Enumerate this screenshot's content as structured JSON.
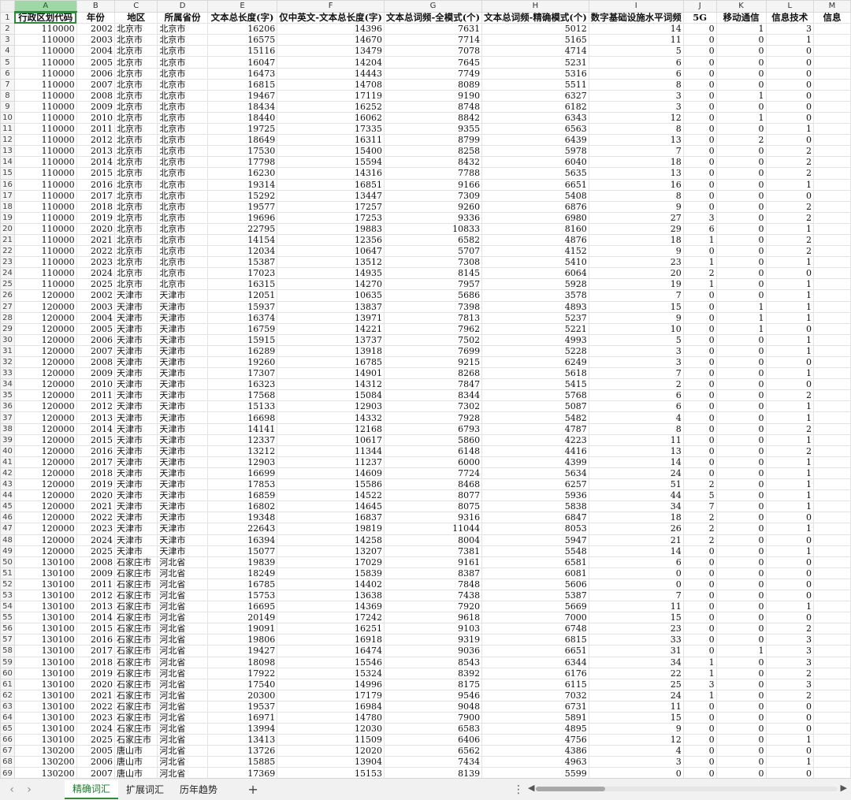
{
  "columns": [
    "A",
    "B",
    "C",
    "D",
    "E",
    "F",
    "G",
    "H",
    "I",
    "J",
    "K",
    "L",
    "M"
  ],
  "active_cell": "A1",
  "header": [
    "行政区划代码",
    "年份",
    "地区",
    "所属省份",
    "文本总长度(字)",
    "仅中英文-文本总长度(字)",
    "文本总词频-全模式(个)",
    "文本总词频-精确模式(个)",
    "数字基础设施水平词频",
    "5G",
    "移动通信",
    "信息技术",
    "信息"
  ],
  "rows": [
    [
      "110000",
      "2002",
      "北京市",
      "北京市",
      "16206",
      "14396",
      "7631",
      "5012",
      "14",
      "0",
      "1",
      "3"
    ],
    [
      "110000",
      "2003",
      "北京市",
      "北京市",
      "16575",
      "14670",
      "7714",
      "5165",
      "11",
      "0",
      "0",
      "1"
    ],
    [
      "110000",
      "2004",
      "北京市",
      "北京市",
      "15116",
      "13479",
      "7078",
      "4714",
      "5",
      "0",
      "0",
      "0"
    ],
    [
      "110000",
      "2005",
      "北京市",
      "北京市",
      "16047",
      "14204",
      "7645",
      "5231",
      "6",
      "0",
      "0",
      "0"
    ],
    [
      "110000",
      "2006",
      "北京市",
      "北京市",
      "16473",
      "14443",
      "7749",
      "5316",
      "6",
      "0",
      "0",
      "0"
    ],
    [
      "110000",
      "2007",
      "北京市",
      "北京市",
      "16815",
      "14708",
      "8089",
      "5511",
      "8",
      "0",
      "0",
      "0"
    ],
    [
      "110000",
      "2008",
      "北京市",
      "北京市",
      "19467",
      "17119",
      "9190",
      "6327",
      "3",
      "0",
      "1",
      "0"
    ],
    [
      "110000",
      "2009",
      "北京市",
      "北京市",
      "18434",
      "16252",
      "8748",
      "6182",
      "3",
      "0",
      "0",
      "0"
    ],
    [
      "110000",
      "2010",
      "北京市",
      "北京市",
      "18440",
      "16062",
      "8842",
      "6343",
      "12",
      "0",
      "1",
      "0"
    ],
    [
      "110000",
      "2011",
      "北京市",
      "北京市",
      "19725",
      "17335",
      "9355",
      "6563",
      "8",
      "0",
      "0",
      "1"
    ],
    [
      "110000",
      "2012",
      "北京市",
      "北京市",
      "18649",
      "16311",
      "8799",
      "6439",
      "13",
      "0",
      "2",
      "0"
    ],
    [
      "110000",
      "2013",
      "北京市",
      "北京市",
      "17530",
      "15400",
      "8258",
      "5978",
      "7",
      "0",
      "0",
      "2"
    ],
    [
      "110000",
      "2014",
      "北京市",
      "北京市",
      "17798",
      "15594",
      "8432",
      "6040",
      "18",
      "0",
      "0",
      "2"
    ],
    [
      "110000",
      "2015",
      "北京市",
      "北京市",
      "16230",
      "14316",
      "7788",
      "5635",
      "13",
      "0",
      "0",
      "2"
    ],
    [
      "110000",
      "2016",
      "北京市",
      "北京市",
      "19314",
      "16851",
      "9166",
      "6651",
      "16",
      "0",
      "0",
      "1"
    ],
    [
      "110000",
      "2017",
      "北京市",
      "北京市",
      "15292",
      "13447",
      "7309",
      "5408",
      "8",
      "0",
      "0",
      "0"
    ],
    [
      "110000",
      "2018",
      "北京市",
      "北京市",
      "19577",
      "17257",
      "9260",
      "6876",
      "9",
      "0",
      "0",
      "2"
    ],
    [
      "110000",
      "2019",
      "北京市",
      "北京市",
      "19696",
      "17253",
      "9336",
      "6980",
      "27",
      "3",
      "0",
      "2"
    ],
    [
      "110000",
      "2020",
      "北京市",
      "北京市",
      "22795",
      "19883",
      "10833",
      "8160",
      "29",
      "6",
      "0",
      "1"
    ],
    [
      "110000",
      "2021",
      "北京市",
      "北京市",
      "14154",
      "12356",
      "6582",
      "4876",
      "18",
      "1",
      "0",
      "2"
    ],
    [
      "110000",
      "2022",
      "北京市",
      "北京市",
      "12034",
      "10647",
      "5707",
      "4152",
      "9",
      "0",
      "0",
      "2"
    ],
    [
      "110000",
      "2023",
      "北京市",
      "北京市",
      "15387",
      "13512",
      "7308",
      "5410",
      "23",
      "1",
      "0",
      "1"
    ],
    [
      "110000",
      "2024",
      "北京市",
      "北京市",
      "17023",
      "14935",
      "8145",
      "6064",
      "20",
      "2",
      "0",
      "0"
    ],
    [
      "110000",
      "2025",
      "北京市",
      "北京市",
      "16315",
      "14270",
      "7957",
      "5928",
      "19",
      "1",
      "0",
      "1"
    ],
    [
      "120000",
      "2002",
      "天津市",
      "天津市",
      "12051",
      "10635",
      "5686",
      "3578",
      "7",
      "0",
      "0",
      "1"
    ],
    [
      "120000",
      "2003",
      "天津市",
      "天津市",
      "15937",
      "13837",
      "7398",
      "4893",
      "15",
      "0",
      "1",
      "1"
    ],
    [
      "120000",
      "2004",
      "天津市",
      "天津市",
      "16374",
      "13971",
      "7813",
      "5237",
      "9",
      "0",
      "1",
      "1"
    ],
    [
      "120000",
      "2005",
      "天津市",
      "天津市",
      "16759",
      "14221",
      "7962",
      "5221",
      "10",
      "0",
      "1",
      "0"
    ],
    [
      "120000",
      "2006",
      "天津市",
      "天津市",
      "15915",
      "13737",
      "7502",
      "4993",
      "5",
      "0",
      "0",
      "1"
    ],
    [
      "120000",
      "2007",
      "天津市",
      "天津市",
      "16289",
      "13918",
      "7699",
      "5228",
      "3",
      "0",
      "0",
      "1"
    ],
    [
      "120000",
      "2008",
      "天津市",
      "天津市",
      "19260",
      "16785",
      "9215",
      "6249",
      "3",
      "0",
      "0",
      "0"
    ],
    [
      "120000",
      "2009",
      "天津市",
      "天津市",
      "17307",
      "14901",
      "8268",
      "5618",
      "7",
      "0",
      "0",
      "1"
    ],
    [
      "120000",
      "2010",
      "天津市",
      "天津市",
      "16323",
      "14312",
      "7847",
      "5415",
      "2",
      "0",
      "0",
      "0"
    ],
    [
      "120000",
      "2011",
      "天津市",
      "天津市",
      "17568",
      "15084",
      "8344",
      "5768",
      "6",
      "0",
      "0",
      "2"
    ],
    [
      "120000",
      "2012",
      "天津市",
      "天津市",
      "15133",
      "12903",
      "7302",
      "5087",
      "6",
      "0",
      "0",
      "1"
    ],
    [
      "120000",
      "2013",
      "天津市",
      "天津市",
      "16698",
      "14332",
      "7928",
      "5482",
      "4",
      "0",
      "0",
      "1"
    ],
    [
      "120000",
      "2014",
      "天津市",
      "天津市",
      "14141",
      "12168",
      "6793",
      "4787",
      "8",
      "0",
      "0",
      "2"
    ],
    [
      "120000",
      "2015",
      "天津市",
      "天津市",
      "12337",
      "10617",
      "5860",
      "4223",
      "11",
      "0",
      "0",
      "1"
    ],
    [
      "120000",
      "2016",
      "天津市",
      "天津市",
      "13212",
      "11344",
      "6148",
      "4416",
      "13",
      "0",
      "0",
      "2"
    ],
    [
      "120000",
      "2017",
      "天津市",
      "天津市",
      "12903",
      "11237",
      "6000",
      "4399",
      "14",
      "0",
      "0",
      "1"
    ],
    [
      "120000",
      "2018",
      "天津市",
      "天津市",
      "16699",
      "14609",
      "7724",
      "5634",
      "24",
      "0",
      "0",
      "1"
    ],
    [
      "120000",
      "2019",
      "天津市",
      "天津市",
      "17853",
      "15586",
      "8468",
      "6257",
      "51",
      "2",
      "0",
      "1"
    ],
    [
      "120000",
      "2020",
      "天津市",
      "天津市",
      "16859",
      "14522",
      "8077",
      "5936",
      "44",
      "5",
      "0",
      "1"
    ],
    [
      "120000",
      "2021",
      "天津市",
      "天津市",
      "16802",
      "14645",
      "8075",
      "5838",
      "34",
      "7",
      "0",
      "1"
    ],
    [
      "120000",
      "2022",
      "天津市",
      "天津市",
      "19348",
      "16837",
      "9316",
      "6847",
      "18",
      "2",
      "0",
      "0"
    ],
    [
      "120000",
      "2023",
      "天津市",
      "天津市",
      "22643",
      "19819",
      "11044",
      "8053",
      "26",
      "2",
      "0",
      "1"
    ],
    [
      "120000",
      "2024",
      "天津市",
      "天津市",
      "16394",
      "14258",
      "8004",
      "5947",
      "21",
      "2",
      "0",
      "0"
    ],
    [
      "120000",
      "2025",
      "天津市",
      "天津市",
      "15077",
      "13207",
      "7381",
      "5548",
      "14",
      "0",
      "0",
      "1"
    ],
    [
      "130100",
      "2008",
      "石家庄市",
      "河北省",
      "19839",
      "17029",
      "9161",
      "6581",
      "6",
      "0",
      "0",
      "0"
    ],
    [
      "130100",
      "2009",
      "石家庄市",
      "河北省",
      "18249",
      "15839",
      "8387",
      "6081",
      "0",
      "0",
      "0",
      "0"
    ],
    [
      "130100",
      "2011",
      "石家庄市",
      "河北省",
      "16785",
      "14402",
      "7848",
      "5606",
      "0",
      "0",
      "0",
      "0"
    ],
    [
      "130100",
      "2012",
      "石家庄市",
      "河北省",
      "15753",
      "13638",
      "7438",
      "5387",
      "7",
      "0",
      "0",
      "0"
    ],
    [
      "130100",
      "2013",
      "石家庄市",
      "河北省",
      "16695",
      "14369",
      "7920",
      "5669",
      "11",
      "0",
      "0",
      "1"
    ],
    [
      "130100",
      "2014",
      "石家庄市",
      "河北省",
      "20149",
      "17242",
      "9618",
      "7000",
      "15",
      "0",
      "0",
      "0"
    ],
    [
      "130100",
      "2015",
      "石家庄市",
      "河北省",
      "19091",
      "16251",
      "9103",
      "6748",
      "23",
      "0",
      "0",
      "2"
    ],
    [
      "130100",
      "2016",
      "石家庄市",
      "河北省",
      "19806",
      "16918",
      "9319",
      "6815",
      "33",
      "0",
      "0",
      "3"
    ],
    [
      "130100",
      "2017",
      "石家庄市",
      "河北省",
      "19427",
      "16474",
      "9036",
      "6651",
      "31",
      "0",
      "1",
      "3"
    ],
    [
      "130100",
      "2018",
      "石家庄市",
      "河北省",
      "18098",
      "15546",
      "8543",
      "6344",
      "34",
      "1",
      "0",
      "3"
    ],
    [
      "130100",
      "2019",
      "石家庄市",
      "河北省",
      "17922",
      "15324",
      "8392",
      "6176",
      "22",
      "1",
      "0",
      "2"
    ],
    [
      "130100",
      "2020",
      "石家庄市",
      "河北省",
      "17540",
      "14996",
      "8175",
      "6115",
      "25",
      "3",
      "0",
      "3"
    ],
    [
      "130100",
      "2021",
      "石家庄市",
      "河北省",
      "20300",
      "17179",
      "9546",
      "7032",
      "24",
      "1",
      "0",
      "2"
    ],
    [
      "130100",
      "2022",
      "石家庄市",
      "河北省",
      "19537",
      "16984",
      "9048",
      "6731",
      "11",
      "0",
      "0",
      "0"
    ],
    [
      "130100",
      "2023",
      "石家庄市",
      "河北省",
      "16971",
      "14780",
      "7900",
      "5891",
      "15",
      "0",
      "0",
      "0"
    ],
    [
      "130100",
      "2024",
      "石家庄市",
      "河北省",
      "13994",
      "12030",
      "6583",
      "4895",
      "9",
      "0",
      "0",
      "0"
    ],
    [
      "130100",
      "2025",
      "石家庄市",
      "河北省",
      "13413",
      "11509",
      "6406",
      "4756",
      "12",
      "0",
      "0",
      "1"
    ],
    [
      "130200",
      "2005",
      "唐山市",
      "河北省",
      "13726",
      "12020",
      "6562",
      "4386",
      "4",
      "0",
      "0",
      "0"
    ],
    [
      "130200",
      "2006",
      "唐山市",
      "河北省",
      "15885",
      "13904",
      "7434",
      "4963",
      "3",
      "0",
      "0",
      "1"
    ],
    [
      "130200",
      "2007",
      "唐山市",
      "河北省",
      "17369",
      "15153",
      "8139",
      "5599",
      "0",
      "0",
      "0",
      "0"
    ]
  ],
  "sheet_tabs": [
    "精确词汇",
    "扩展词汇",
    "历年趋势"
  ],
  "active_tab": "精确词汇",
  "icons": {
    "prev": "chevron-left-icon",
    "next": "chevron-right-icon",
    "add": "plus-icon",
    "more": "vertical-dots-icon"
  },
  "colors": {
    "selection": "#2e8b3d",
    "selected_header": "#9fd7a6"
  }
}
